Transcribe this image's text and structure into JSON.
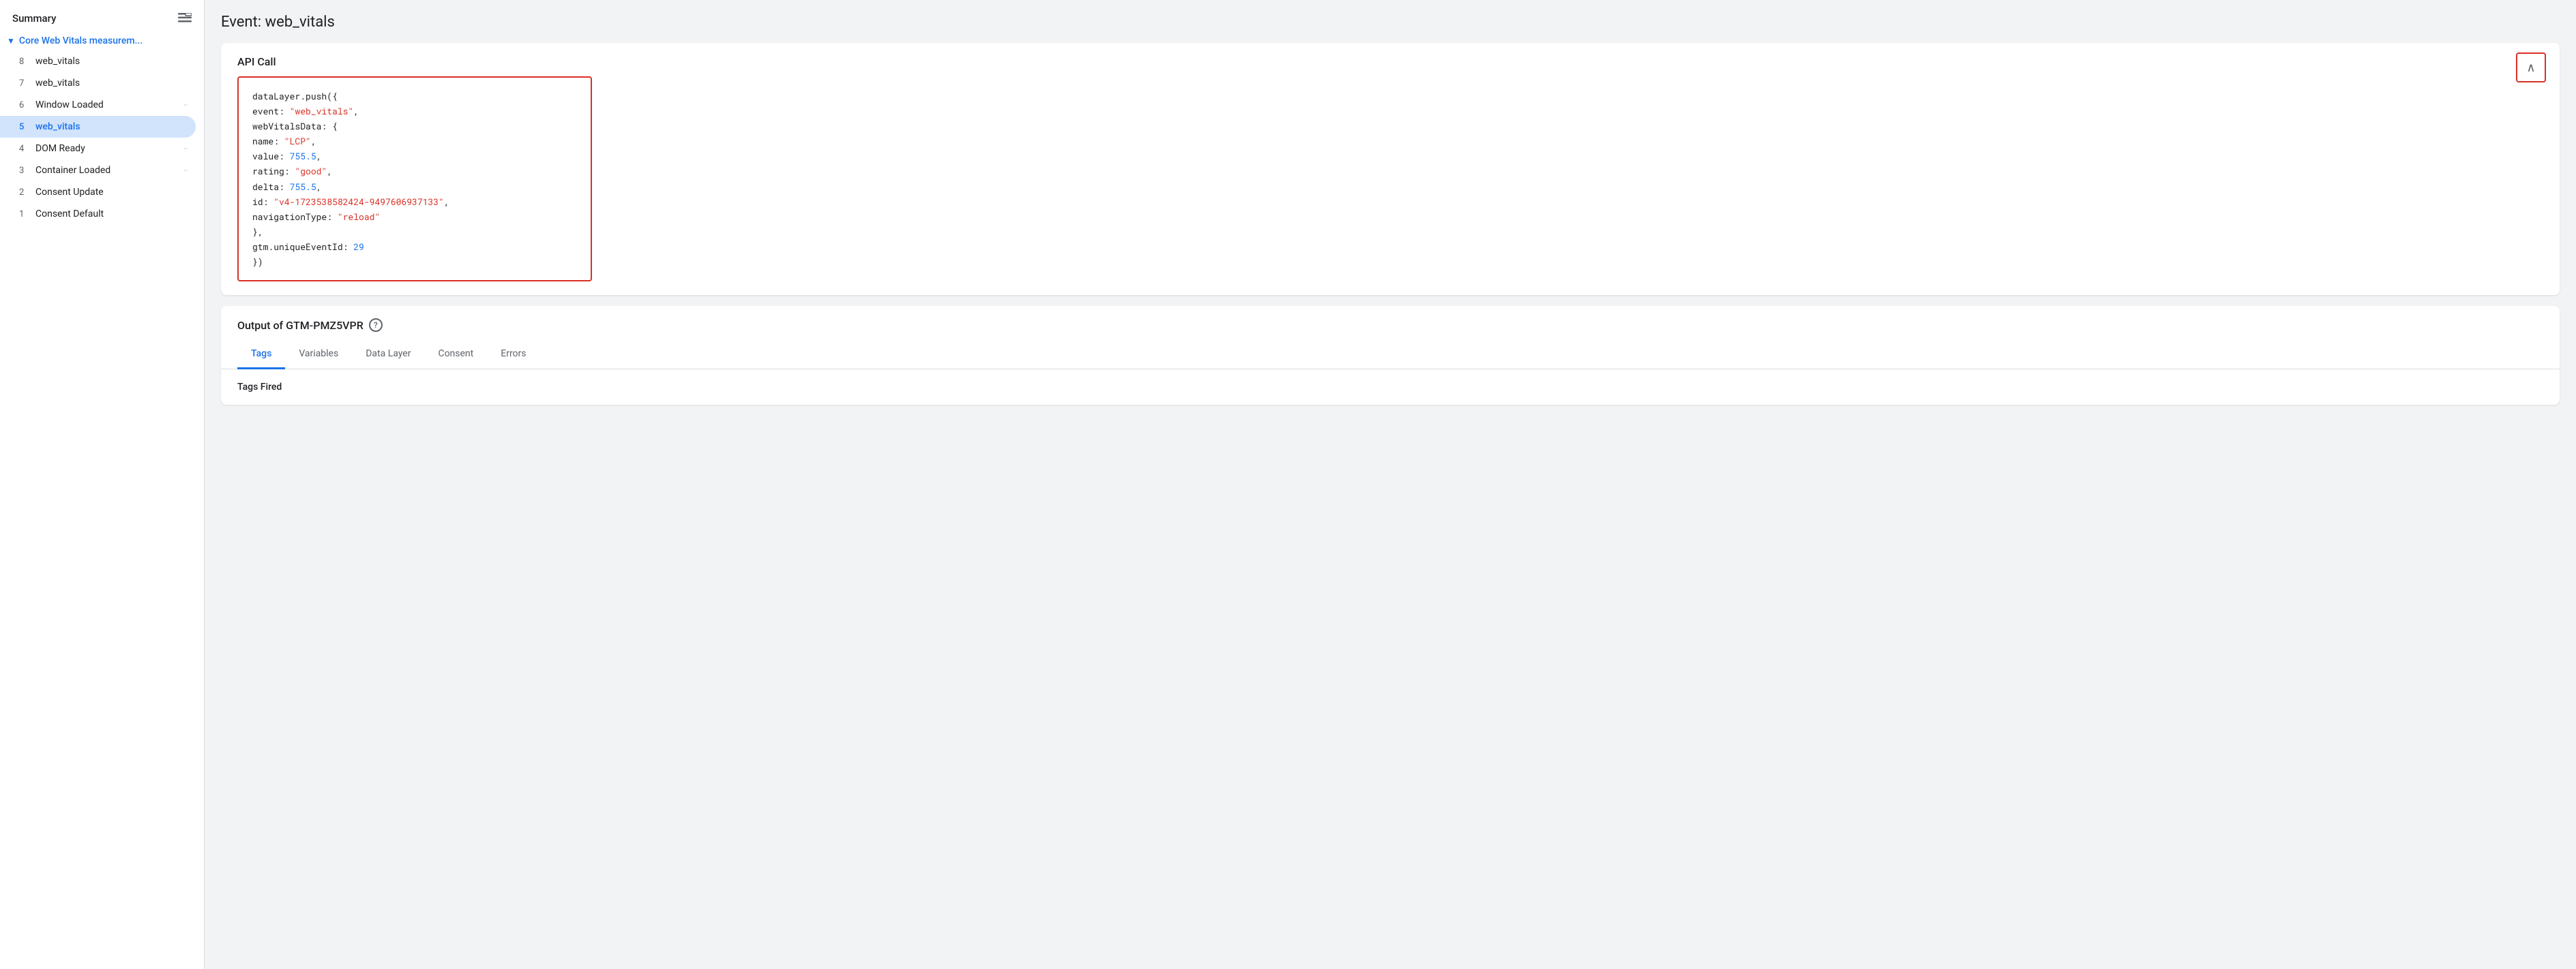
{
  "sidebar": {
    "summary_label": "Summary",
    "group": {
      "label": "Core Web Vitals measurem...",
      "chevron": "▼"
    },
    "items": [
      {
        "number": "8",
        "name": "web_vitals",
        "icon": null,
        "active": false
      },
      {
        "number": "7",
        "name": "web_vitals",
        "icon": null,
        "active": false
      },
      {
        "number": "6",
        "name": "Window Loaded",
        "icon": "</>",
        "active": false
      },
      {
        "number": "5",
        "name": "web_vitals",
        "icon": null,
        "active": true
      },
      {
        "number": "4",
        "name": "DOM Ready",
        "icon": "</>",
        "active": false
      },
      {
        "number": "3",
        "name": "Container Loaded",
        "icon": "</>",
        "active": false
      },
      {
        "number": "2",
        "name": "Consent Update",
        "icon": null,
        "active": false
      },
      {
        "number": "1",
        "name": "Consent Default",
        "icon": null,
        "active": false
      }
    ]
  },
  "page_title": "Event: web_vitals",
  "api_call": {
    "header": "API Call",
    "code_lines": [
      {
        "type": "plain",
        "text": "dataLayer.push({"
      },
      {
        "type": "mixed",
        "parts": [
          {
            "t": "key",
            "v": "  event: "
          },
          {
            "t": "string",
            "v": "\"web_vitals\""
          },
          {
            "t": "key",
            "v": ","
          }
        ]
      },
      {
        "type": "mixed",
        "parts": [
          {
            "t": "key",
            "v": "  webVitalsData: {"
          }
        ]
      },
      {
        "type": "mixed",
        "parts": [
          {
            "t": "key",
            "v": "    name: "
          },
          {
            "t": "string",
            "v": "\"LCP\""
          },
          {
            "t": "key",
            "v": ","
          }
        ]
      },
      {
        "type": "mixed",
        "parts": [
          {
            "t": "key",
            "v": "    value: "
          },
          {
            "t": "number",
            "v": "755.5"
          },
          {
            "t": "key",
            "v": ","
          }
        ]
      },
      {
        "type": "mixed",
        "parts": [
          {
            "t": "key",
            "v": "    rating: "
          },
          {
            "t": "string",
            "v": "\"good\""
          },
          {
            "t": "key",
            "v": ","
          }
        ]
      },
      {
        "type": "mixed",
        "parts": [
          {
            "t": "key",
            "v": "    delta: "
          },
          {
            "t": "number",
            "v": "755.5"
          },
          {
            "t": "key",
            "v": ","
          }
        ]
      },
      {
        "type": "mixed",
        "parts": [
          {
            "t": "key",
            "v": "    id: "
          },
          {
            "t": "string",
            "v": "\"v4-1723538582424-9497606937133\""
          },
          {
            "t": "key",
            "v": ","
          }
        ]
      },
      {
        "type": "mixed",
        "parts": [
          {
            "t": "key",
            "v": "    navigationType: "
          },
          {
            "t": "string",
            "v": "\"reload\""
          }
        ]
      },
      {
        "type": "plain",
        "text": "  },"
      },
      {
        "type": "mixed",
        "parts": [
          {
            "t": "key",
            "v": "  gtm.uniqueEventId: "
          },
          {
            "t": "number",
            "v": "29"
          }
        ]
      },
      {
        "type": "plain",
        "text": "})"
      }
    ],
    "collapse_icon": "∧"
  },
  "output": {
    "header": "Output of GTM-PMZ5VPR",
    "help_icon": "?",
    "tabs": [
      {
        "label": "Tags",
        "active": true
      },
      {
        "label": "Variables",
        "active": false
      },
      {
        "label": "Data Layer",
        "active": false
      },
      {
        "label": "Consent",
        "active": false
      },
      {
        "label": "Errors",
        "active": false
      }
    ],
    "tags_fired_label": "Tags Fired"
  },
  "colors": {
    "accent_blue": "#1a73e8",
    "border_red": "#d93025",
    "string_red": "#d93025",
    "number_blue": "#1a73e8"
  }
}
